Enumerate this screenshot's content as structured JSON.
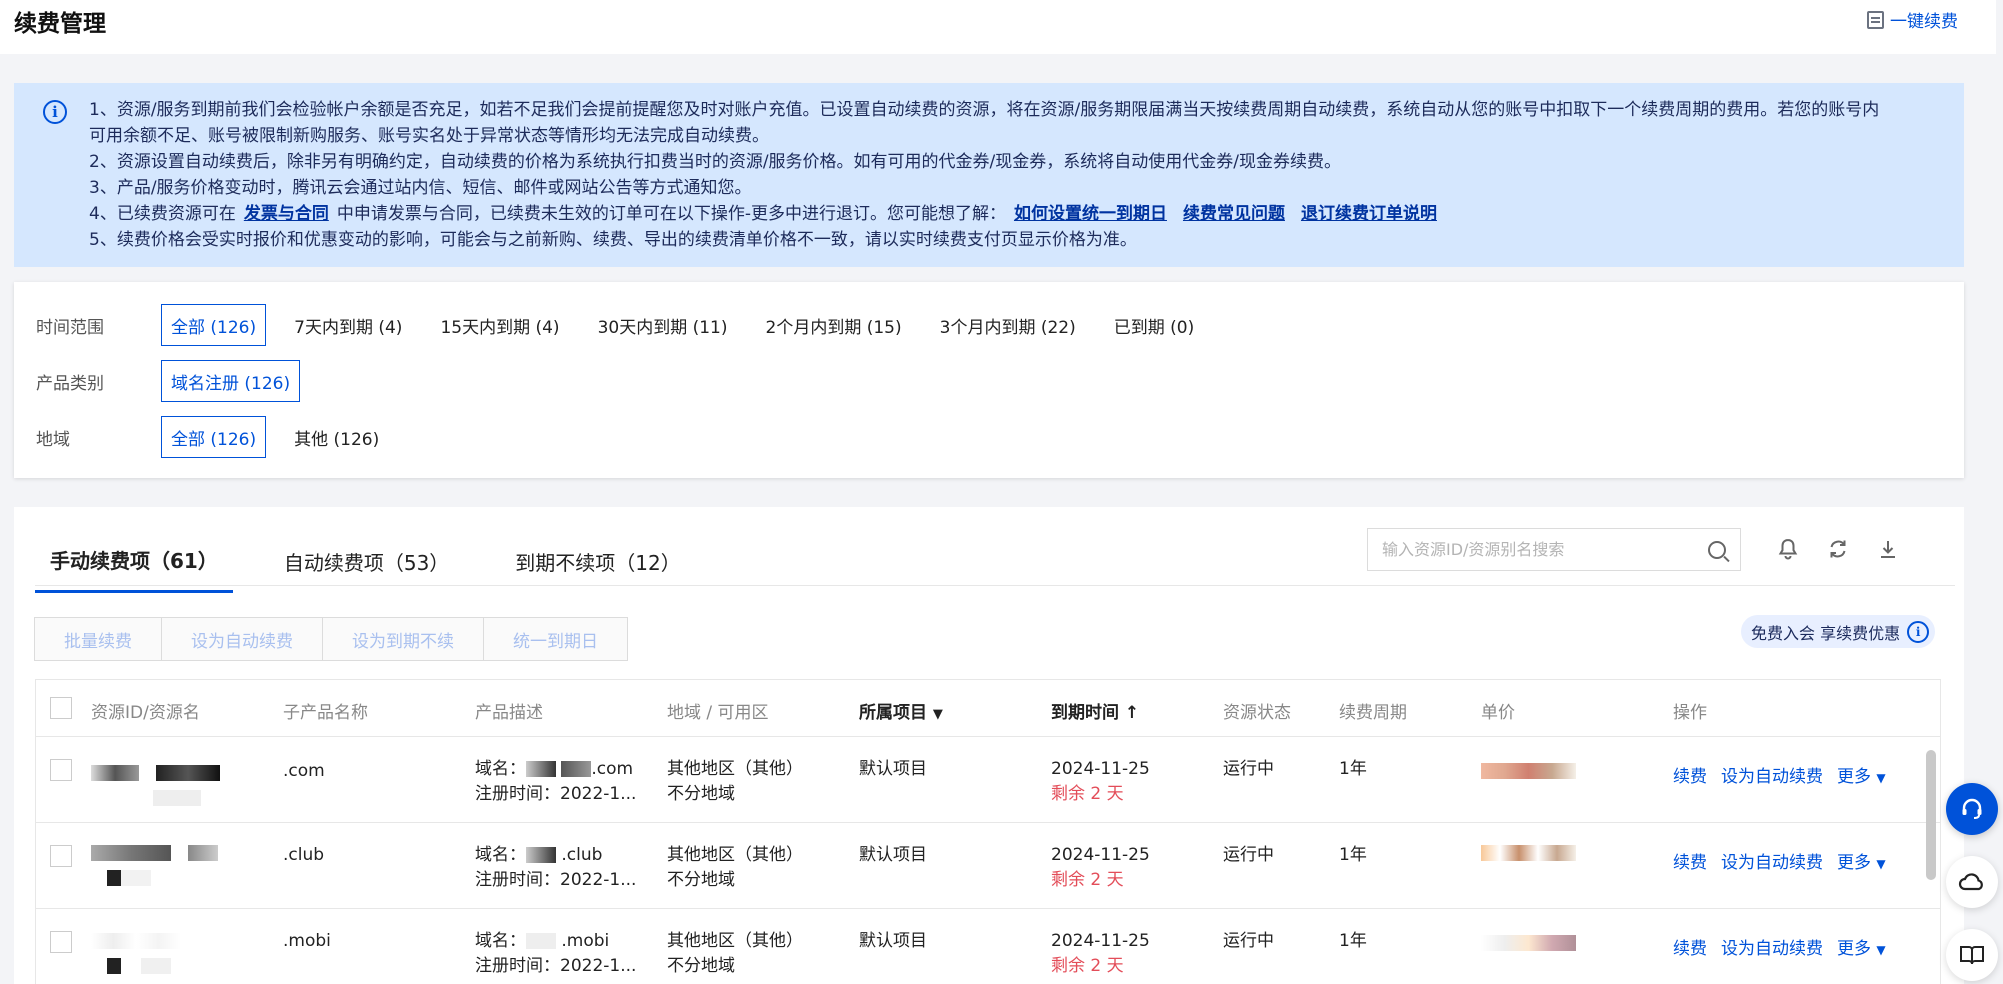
{
  "header": {
    "title": "续费管理",
    "one_key_renew": "一键续费"
  },
  "notice": {
    "lines": [
      "1、资源/服务到期前我们会检验帐户余额是否充足，如若不足我们会提前提醒您及时对账户充值。已设置自动续费的资源，将在资源/服务期限届满当天按续费周期自动续费，系统自动从您的账号中扣取下一个续费周期的费用。若您的账号内",
      "可用余额不足、账号被限制新购服务、账号实名处于异常状态等情形均无法完成自动续费。",
      "2、资源设置自动续费后，除非另有明确约定，自动续费的价格为系统执行扣费当时的资源/服务价格。如有可用的代金券/现金券，系统将自动使用代金券/现金券续费。",
      "3、产品/服务价格变动时，腾讯云会通过站内信、短信、邮件或网站公告等方式通知您。",
      "5、续费价格会受实时报价和优惠变动的影响，可能会与之前新购、续费、导出的续费清单价格不一致，请以实时续费支付页显示价格为准。"
    ],
    "line4": {
      "prefix": "4、已续费资源可在",
      "link_invoice": "发票与合同",
      "middle": "中申请发票与合同，已续费未生效的订单可在以下操作-更多中进行退订。您可能想了解：",
      "link_unify": "如何设置统一到期日",
      "link_faq": "续费常见问题",
      "link_refund": "退订续费订单说明"
    }
  },
  "filters": {
    "time": {
      "label": "时间范围",
      "options": [
        "全部 (126)",
        "7天内到期 (4)",
        "15天内到期 (4)",
        "30天内到期 (11)",
        "2个月内到期 (15)",
        "3个月内到期 (22)",
        "已到期 (0)"
      ]
    },
    "product": {
      "label": "产品类别",
      "options": [
        "域名注册 (126)"
      ]
    },
    "region": {
      "label": "地域",
      "options": [
        "全部 (126)",
        "其他 (126)"
      ]
    }
  },
  "tabs": [
    "手动续费项（61）",
    "自动续费项（53）",
    "到期不续项（12）"
  ],
  "search": {
    "placeholder": "输入资源ID/资源别名搜索"
  },
  "toolbar": {
    "icons": [
      "bell-icon",
      "refresh-icon",
      "download-icon"
    ]
  },
  "actions": [
    "批量续费",
    "设为自动续费",
    "设为到期不续",
    "统一到期日"
  ],
  "promo": "免费入会 享续费优惠",
  "table": {
    "columns": [
      "资源ID/资源名",
      "子产品名称",
      "产品描述",
      "地域 / 可用区",
      "所属项目",
      "到期时间",
      "资源状态",
      "续费周期",
      "单价",
      "操作"
    ],
    "rows": [
      {
        "sub_product": ".com",
        "domain_prefix": "域名：",
        "domain_suffix": ".com",
        "reg_time": "注册时间：2022-1...",
        "region": "其他地区（其他）",
        "zone": "不分地域",
        "project": "默认项目",
        "expire": "2024-11-25",
        "remain": "剩余 2 天",
        "status": "运行中",
        "period": "1年",
        "op_renew": "续费",
        "op_auto": "设为自动续费",
        "op_more": "更多"
      },
      {
        "sub_product": ".club",
        "domain_prefix": "域名：",
        "domain_suffix": ".club",
        "reg_time": "注册时间：2022-1...",
        "region": "其他地区（其他）",
        "zone": "不分地域",
        "project": "默认项目",
        "expire": "2024-11-25",
        "remain": "剩余 2 天",
        "status": "运行中",
        "period": "1年",
        "op_renew": "续费",
        "op_auto": "设为自动续费",
        "op_more": "更多"
      },
      {
        "sub_product": ".mobi",
        "domain_prefix": "域名：",
        "domain_suffix": ".mobi",
        "reg_time": "注册时间：2022-1...",
        "region": "其他地区（其他）",
        "zone": "不分地域",
        "project": "默认项目",
        "expire": "2024-11-25",
        "remain": "剩余 2 天",
        "status": "运行中",
        "period": "1年",
        "op_renew": "续费",
        "op_auto": "设为自动续费",
        "op_more": "更多"
      }
    ]
  },
  "colors": {
    "accent": "#0052d9",
    "notice_bg": "#d5e7fe",
    "danger": "#e34d59"
  }
}
